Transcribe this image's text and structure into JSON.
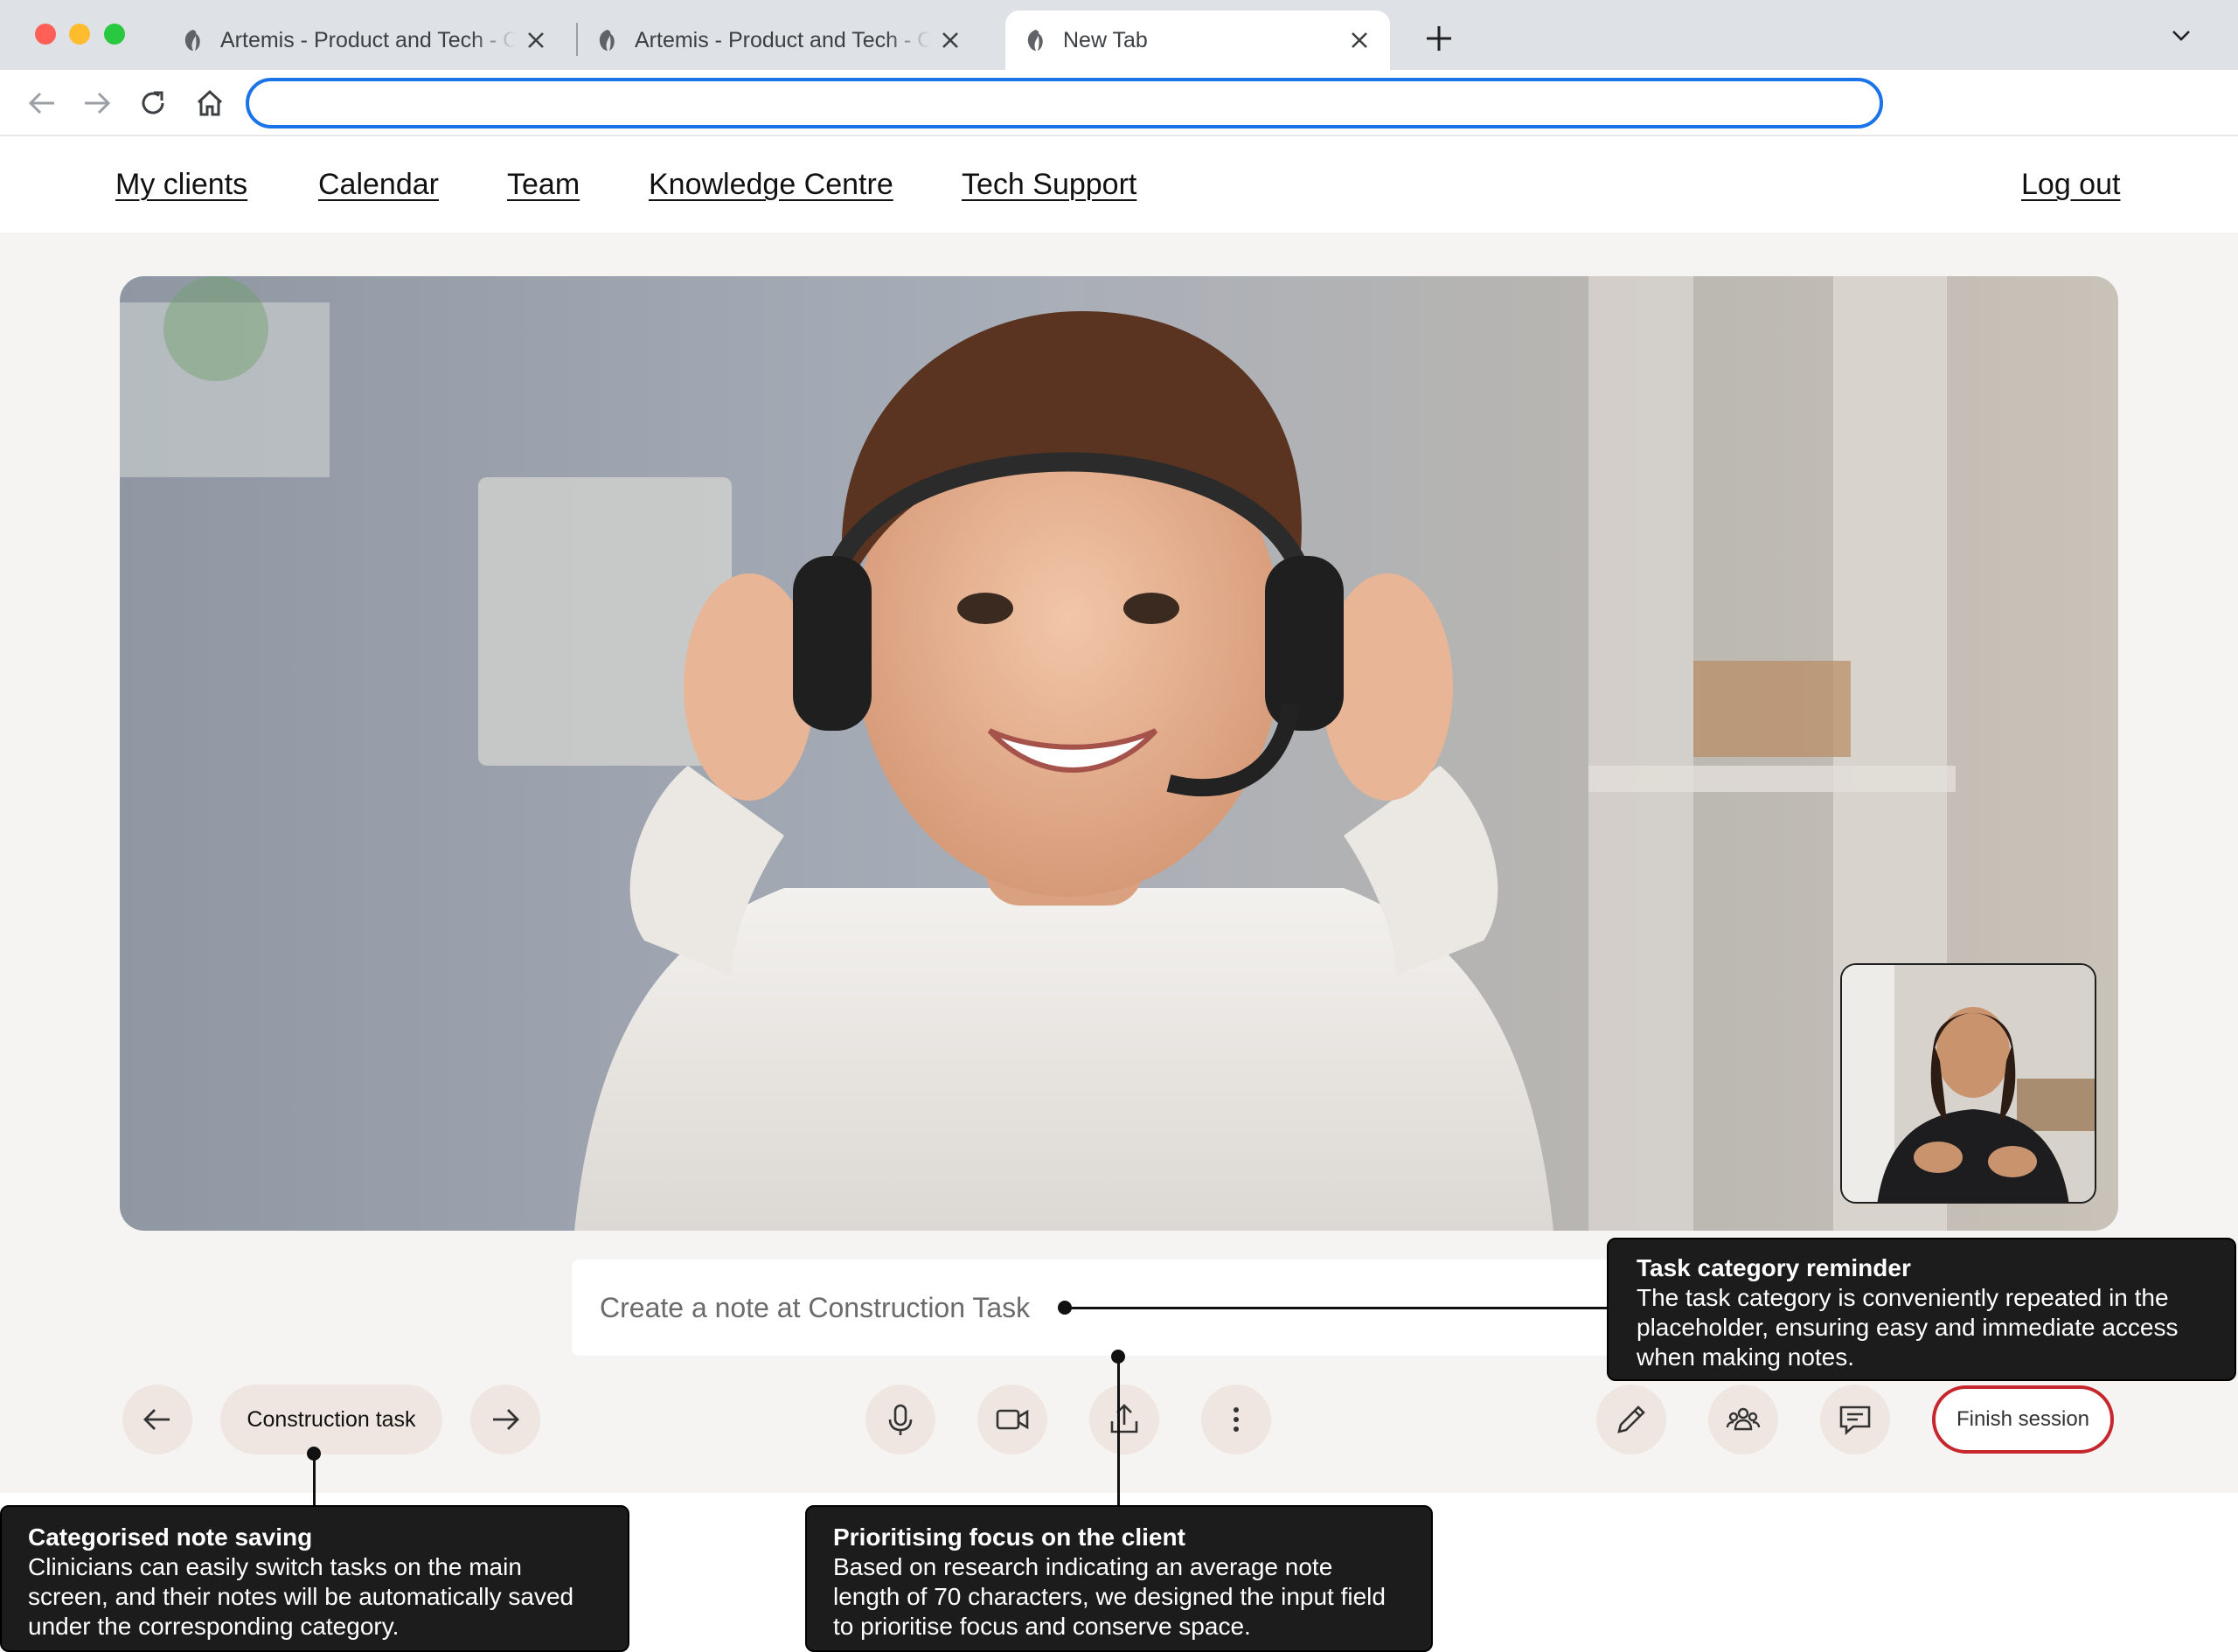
{
  "browser": {
    "tabs": [
      {
        "title": "Artemis - Product and Tech - Co",
        "active": false
      },
      {
        "title": "Artemis - Product and Tech - Co",
        "active": false
      },
      {
        "title": "New Tab",
        "active": true
      }
    ],
    "address_value": ""
  },
  "nav": {
    "my_clients": "My clients",
    "calendar": "Calendar",
    "team": "Team",
    "knowledge_centre": "Knowledge Centre",
    "tech_support": "Tech Support",
    "log_out": "Log out"
  },
  "session": {
    "note_placeholder": "Create a note at Construction Task",
    "task_label": "Construction task",
    "finish_label": "Finish session"
  },
  "annotations": {
    "task_category": {
      "heading": "Task category reminder",
      "body": "The task category is conveniently repeated in the placeholder, ensuring easy and immediate access when making notes."
    },
    "categorised": {
      "heading": "Categorised note saving",
      "body": "Clinicians can easily switch tasks on the main screen, and their notes will be automatically saved under the corresponding category."
    },
    "focus": {
      "heading": "Prioritising focus on the client",
      "body": "Based on research indicating an average note length of 70 characters, we designed the input field to prioritise focus and conserve space."
    }
  },
  "colors": {
    "accent": "#1a73e8",
    "finish_border": "#c6262e",
    "button_bg": "#efe6e1",
    "stage_bg": "#f6f4f2"
  }
}
